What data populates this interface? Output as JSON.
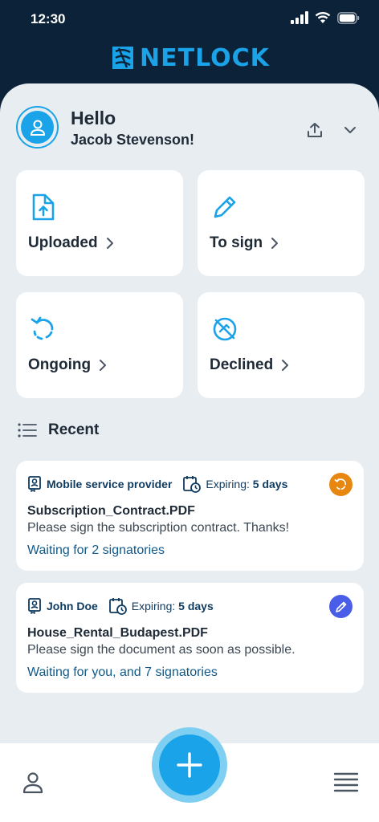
{
  "status_bar": {
    "time": "12:30"
  },
  "brand": {
    "name": "NETLOCK"
  },
  "greeting": {
    "hello": "Hello",
    "name": "Jacob Stevenson!"
  },
  "tiles": [
    {
      "label": "Uploaded",
      "icon": "upload-document-icon"
    },
    {
      "label": "To sign",
      "icon": "pencil-icon"
    },
    {
      "label": "Ongoing",
      "icon": "refresh-dashed-icon"
    },
    {
      "label": "Declined",
      "icon": "declined-icon"
    }
  ],
  "recent": {
    "title": "Recent",
    "items": [
      {
        "sender": "Mobile service provider",
        "expiring_label": "Expiring:",
        "expiring_value": "5 days",
        "filename": "Subscription_Contract.PDF",
        "description": "Please sign the subscription contract. Thanks!",
        "waiting": "Waiting for 2 signatories",
        "status_color": "#e8870f"
      },
      {
        "sender": "John Doe",
        "expiring_label": "Expiring:",
        "expiring_value": "5 days",
        "filename": "House_Rental_Budapest.PDF",
        "description": "Please sign the document as soon as possible.",
        "waiting": "Waiting for you, and 7 signatories",
        "status_color": "#4a5de8"
      }
    ]
  },
  "colors": {
    "accent": "#1aa3e8",
    "header": "#0b2238",
    "background": "#e8edf2"
  }
}
